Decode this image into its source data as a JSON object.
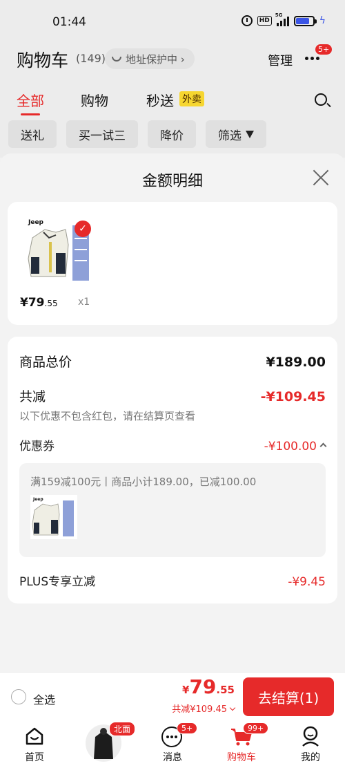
{
  "status_bar": {
    "time": "01:44",
    "hd": "HD",
    "signal": "5G"
  },
  "cart_header": {
    "title": "购物车",
    "count": "(149)",
    "address_protect": "地址保护中 ›",
    "manage": "管理",
    "more_badge": "5+",
    "tabs": [
      {
        "label": "全部",
        "active": true
      },
      {
        "label": "购物",
        "active": false
      },
      {
        "label": "秒送",
        "active": false
      }
    ],
    "tab_badge": "外卖",
    "chips": [
      "送礼",
      "买一试三",
      "降价",
      "筛选"
    ]
  },
  "sheet": {
    "title": "金额明细",
    "product": {
      "brand": "Jeep",
      "price_int": "¥79",
      "price_dec": ".55",
      "qty": "x1"
    },
    "detail": {
      "total_label": "商品总价",
      "total_value": "¥189.00",
      "reduce_label": "共减",
      "reduce_value": "-¥109.45",
      "note": "以下优惠不包含红包，请在结算页查看",
      "coupon_label": "优惠券",
      "coupon_value": "-¥100.00",
      "coupon_desc": "满159减100元丨商品小计189.00，已减100.00",
      "plus_label": "PLUS专享立减",
      "plus_value": "-¥9.45"
    }
  },
  "checkout": {
    "select_all": "全选",
    "currency": "¥",
    "price_int": "79",
    "price_dec": ".55",
    "saved": "共减¥109.45",
    "button": "去结算(1)"
  },
  "tabbar": {
    "items": [
      {
        "label": "首页",
        "icon": "home-icon"
      },
      {
        "label": "",
        "icon": "jacket-promo"
      },
      {
        "label": "消息",
        "icon": "message-icon"
      },
      {
        "label": "购物车",
        "icon": "cart-icon"
      },
      {
        "label": "我的",
        "icon": "profile-icon"
      }
    ],
    "promo_badge": "北面",
    "message_badge": "5+",
    "cart_badge": "99+"
  },
  "colors": {
    "accent": "#e62a2a",
    "battery": "#3b55e6"
  }
}
